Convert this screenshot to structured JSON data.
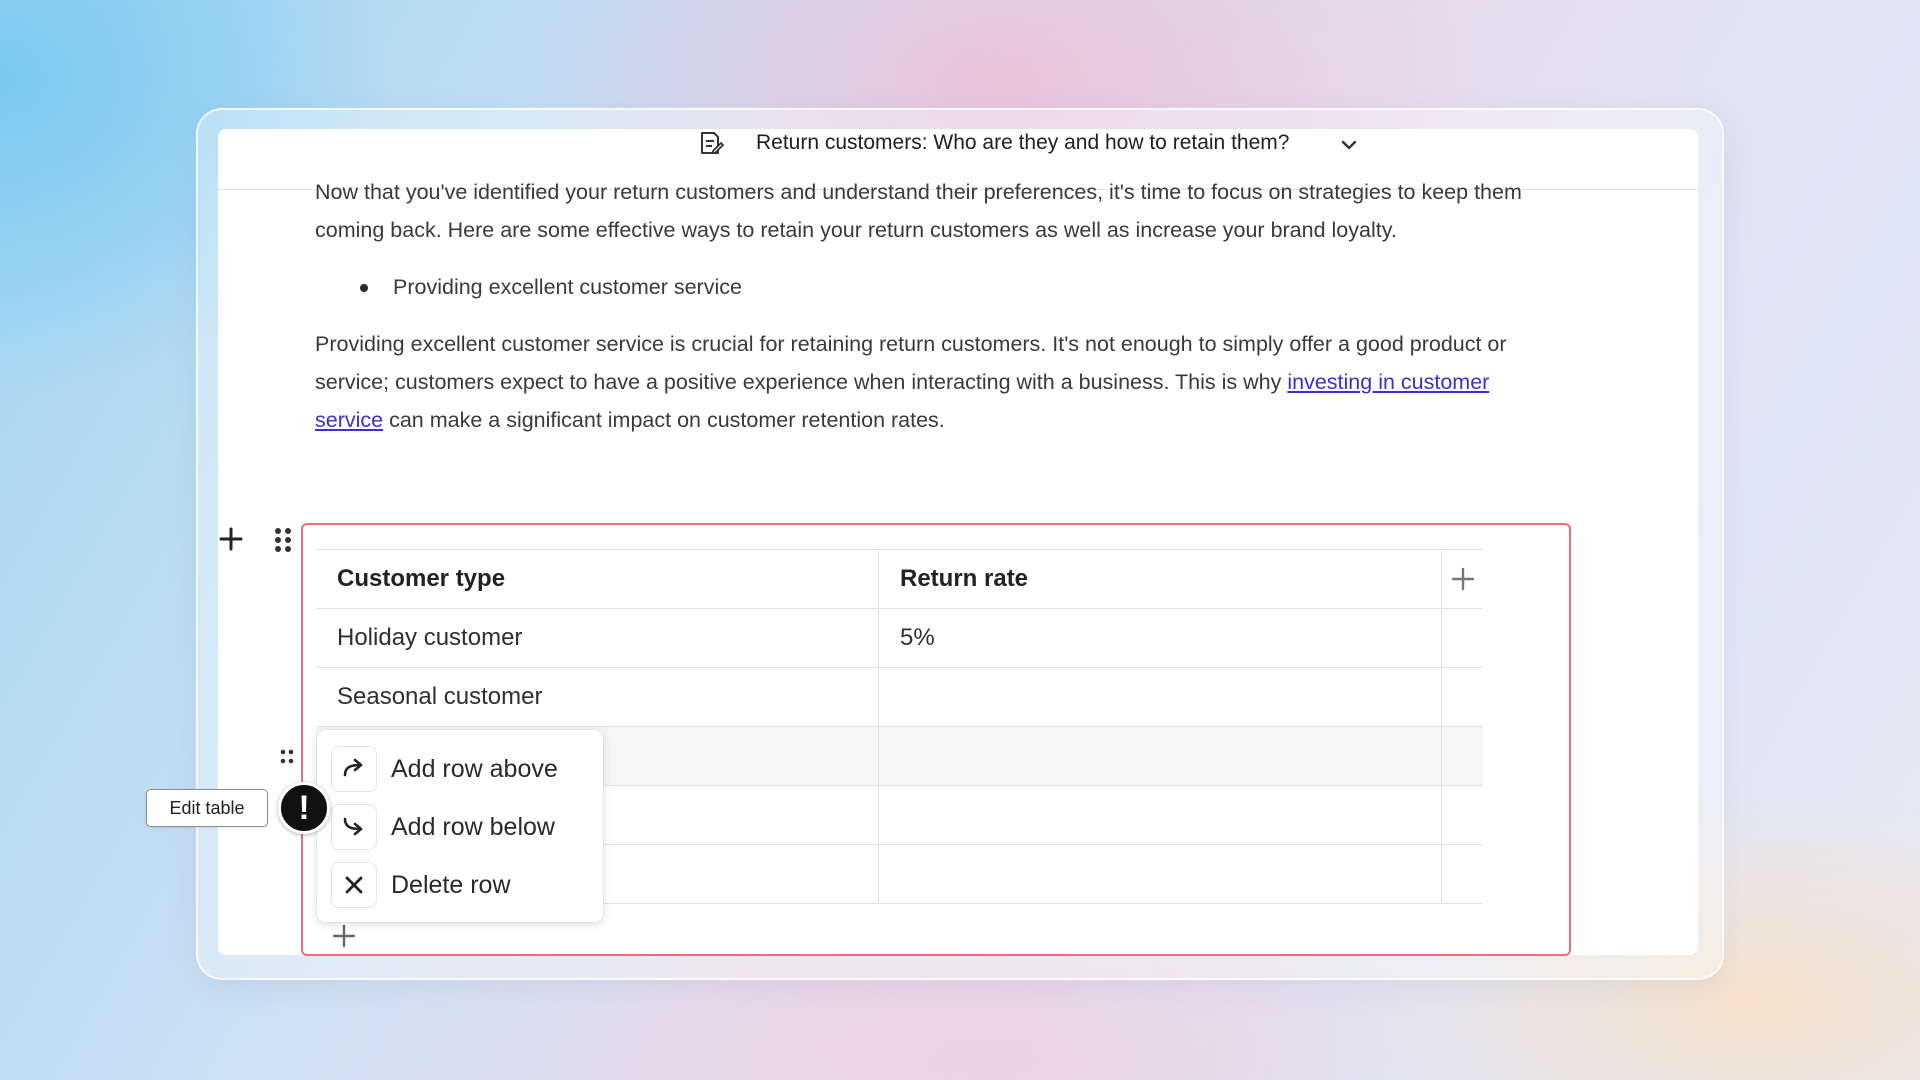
{
  "document": {
    "title": "Return customers: Who are they and how to retain them?",
    "intro_paragraph": "Now that you've identified your return customers and understand their preferences, it's time to focus on strategies to keep them coming back. Here are some effective ways to retain your return customers as well as increase your brand loyalty.",
    "bullets": [
      "Providing excellent customer service"
    ],
    "paragraph2": {
      "before_link": "Providing excellent customer service is crucial for retaining return customers. It's not enough to simply offer a good product or service; customers expect to have a positive experience when interacting with a business. This is why ",
      "link_text": "investing in customer service",
      "after_link": " can make a significant impact on customer retention rates."
    }
  },
  "table": {
    "headers": [
      "Customer type",
      "Return rate"
    ],
    "rows": [
      [
        "Holiday customer",
        "5%"
      ],
      [
        "Seasonal customer",
        ""
      ],
      [
        "",
        ""
      ],
      [
        "",
        ""
      ],
      [
        "",
        ""
      ]
    ],
    "highlighted_row_index": 2
  },
  "context_menu": {
    "items": [
      {
        "label": "Add row above",
        "icon": "arrow-redo-icon"
      },
      {
        "label": "Add row below",
        "icon": "arrow-return-down-icon"
      },
      {
        "label": "Delete row",
        "icon": "close-icon"
      }
    ]
  },
  "tooltip": {
    "label": "Edit table"
  },
  "alert_marker": {
    "symbol": "!"
  },
  "colors": {
    "selection_border": "#e8707a",
    "link": "#3b2fd1",
    "highlight_row": "#f6f6f7"
  }
}
